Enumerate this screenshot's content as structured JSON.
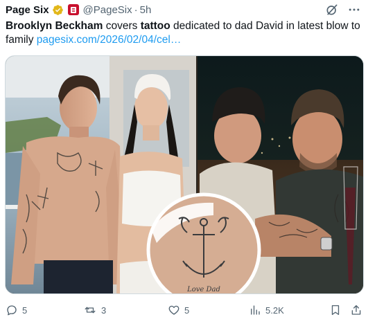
{
  "post": {
    "author": {
      "display_name": "Page Six",
      "handle": "@PageSix",
      "separator": "·",
      "time": "5h",
      "verified_badge": "gold-check-icon",
      "affiliate_badge": "page-six-badge-icon"
    },
    "text": {
      "p1": "Brooklyn Beckham",
      "p2": " covers ",
      "p3": "tattoo",
      "p4": " dedicated to dad David in latest blow to family ",
      "link": "pagesix.com/2026/02/04/cel…"
    },
    "header_actions": [
      "grok-icon",
      "more-icon"
    ],
    "media": {
      "tattoo_text": "Love  Dad"
    },
    "actions": {
      "replies": "5",
      "reposts": "3",
      "likes": "5",
      "views": "5.2K"
    },
    "colors": {
      "link": "#1d9bf0",
      "text": "#0f1419",
      "muted": "#536471",
      "verified": "#e2b719"
    }
  }
}
